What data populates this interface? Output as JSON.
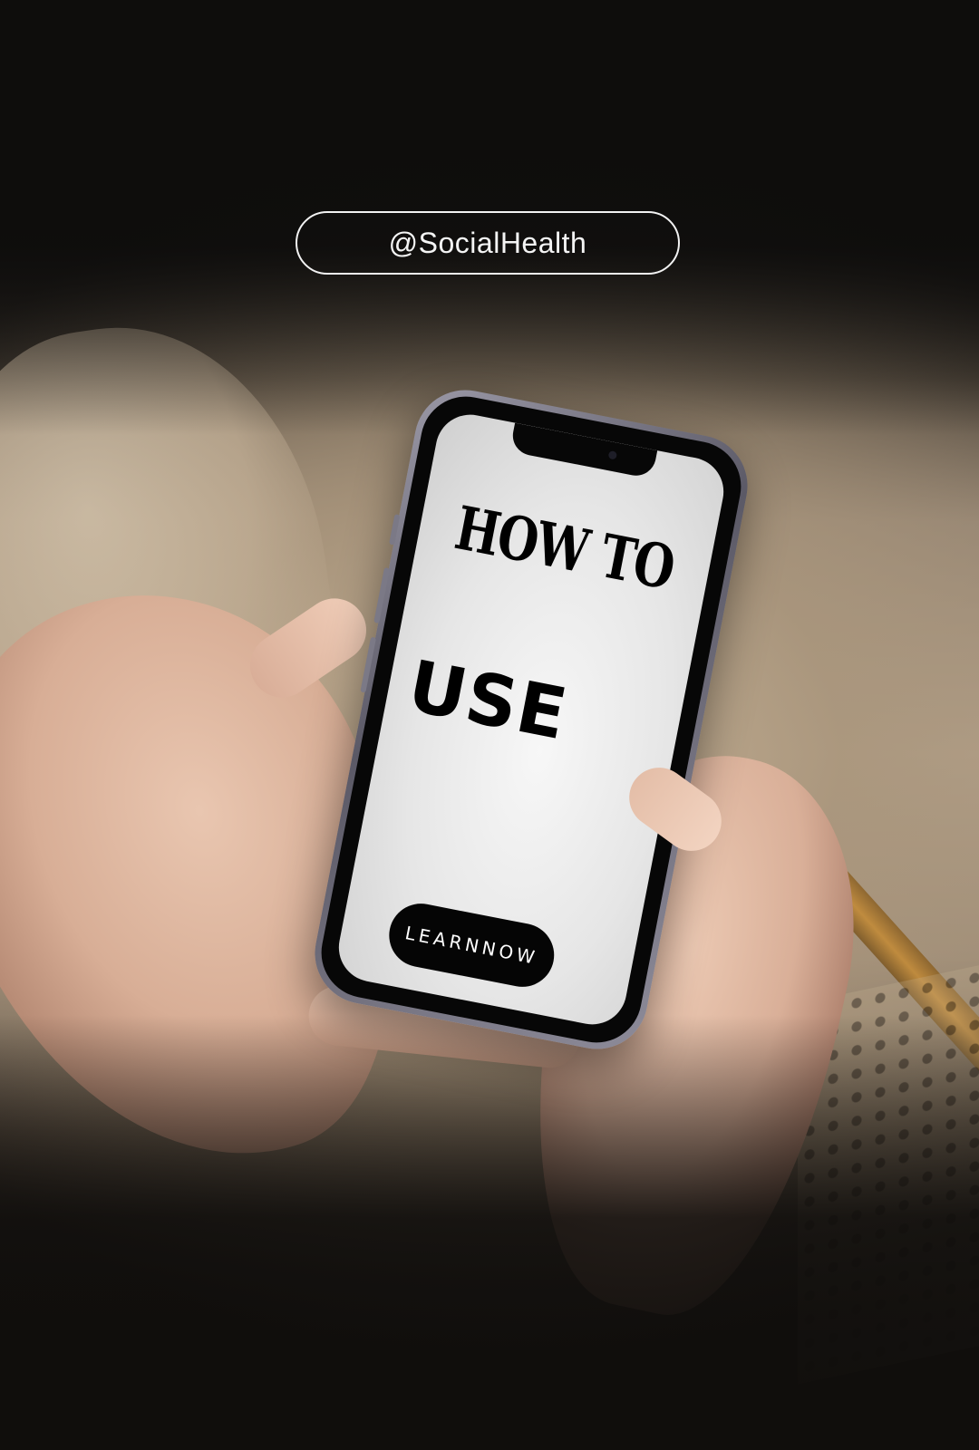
{
  "header": {
    "handle": "@SocialHealth"
  },
  "phone_screen": {
    "title_line1": "HOW TO",
    "title_line2": "USE",
    "cta_label": "LEARNNOW"
  },
  "colors": {
    "background": "#110f0d",
    "pill_border": "#f2f2f2",
    "screen": "#efefef",
    "button": "#050505"
  },
  "icons": [
    "phone-notch-icon",
    "camera-icon"
  ]
}
